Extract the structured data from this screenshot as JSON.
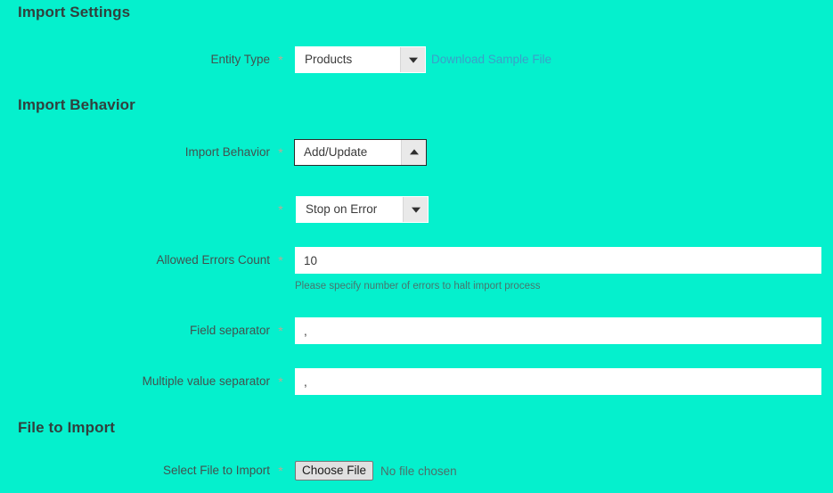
{
  "theme": {
    "background": "#05f0cd",
    "heading_color": "#31403d",
    "label_color": "#41524f",
    "link_color": "#3aa0c9",
    "note_color": "#47766e",
    "field_bg": "#ffffff",
    "required_marker": "*"
  },
  "sections": {
    "import_settings": {
      "title": "Import Settings"
    },
    "import_behavior": {
      "title": "Import Behavior"
    },
    "file_to_import": {
      "title": "File to Import"
    }
  },
  "fields": {
    "entity_type": {
      "label": "Entity Type",
      "required": "*",
      "value": "Products",
      "arrow": "chevron-down",
      "link_label": "Download Sample File"
    },
    "import_behavior": {
      "label": "Import Behavior",
      "required": "*",
      "value": "Add/Update",
      "arrow": "chevron-up"
    },
    "error_handling": {
      "label": "",
      "required": "*",
      "value": "Stop on Error",
      "arrow": "chevron-down"
    },
    "allowed_errors_count": {
      "label": "Allowed Errors Count",
      "required": "*",
      "value": "10",
      "placeholder": "",
      "note": "Please specify number of errors to halt import process"
    },
    "field_separator": {
      "label": "Field separator",
      "required": "*",
      "value": ",",
      "placeholder": ""
    },
    "multiple_value_separator": {
      "label": "Multiple value separator",
      "required": "*",
      "value": ",",
      "placeholder": ""
    },
    "select_file_to_import": {
      "label": "Select File to Import",
      "required": "*",
      "button_label": "Choose File",
      "status_text": "No file chosen"
    }
  }
}
